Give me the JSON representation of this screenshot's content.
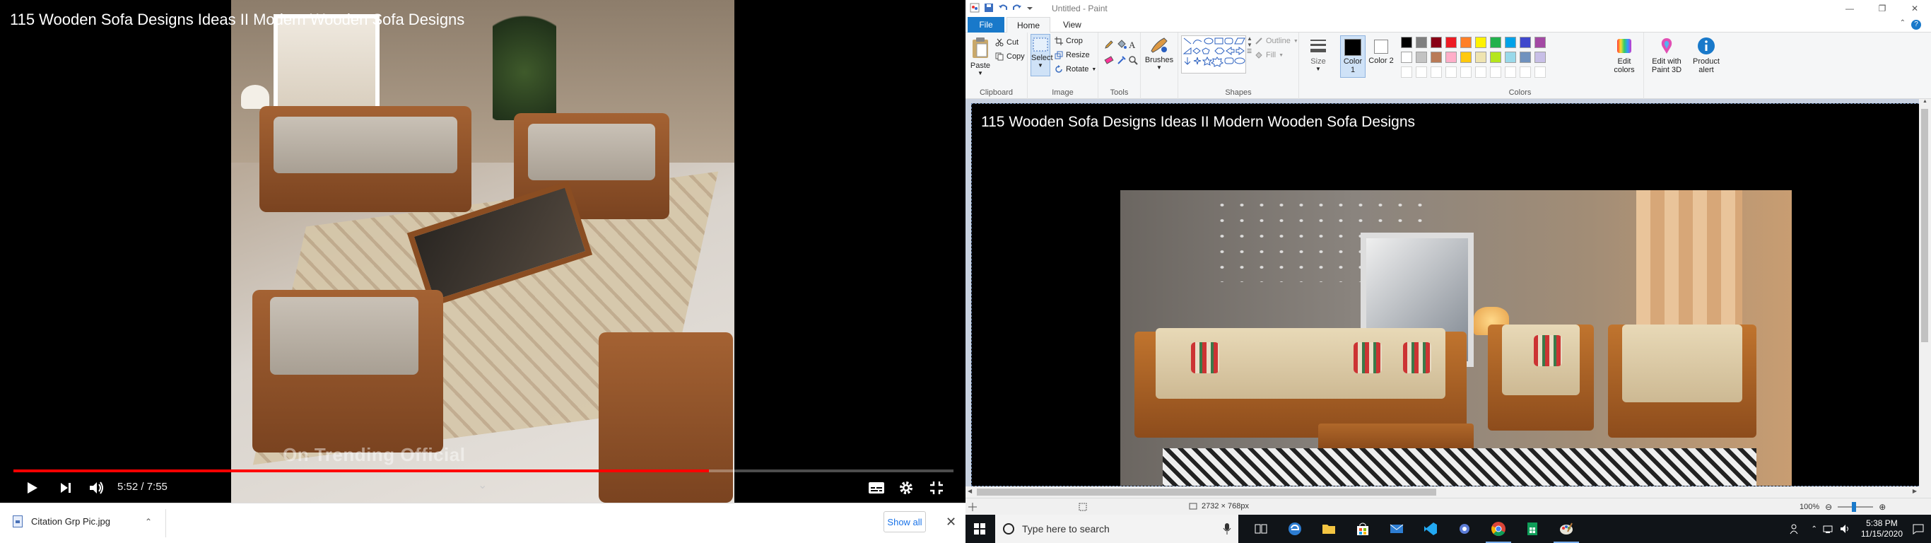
{
  "player": {
    "title": "115 Wooden Sofa Designs Ideas II Modern Wooden Sofa Designs",
    "watermark": "On Trending Official",
    "time": "5:52 / 7:55",
    "progress": 0.74
  },
  "downloads": {
    "file_name": "Citation Grp Pic.jpg",
    "show_all": "Show all"
  },
  "paint": {
    "window_title": "Untitled - Paint",
    "tabs": [
      "File",
      "Home",
      "View"
    ],
    "clipboard": {
      "paste": "Paste",
      "cut": "Cut",
      "copy": "Copy",
      "label": "Clipboard"
    },
    "image": {
      "select": "Select",
      "crop": "Crop",
      "resize": "Resize",
      "rotate": "Rotate",
      "label": "Image"
    },
    "tools": {
      "label": "Tools"
    },
    "brushes": "Brushes",
    "shapes": {
      "outline": "Outline",
      "fill": "Fill",
      "label": "Shapes"
    },
    "size": "Size",
    "color1": "Color 1",
    "color2": "Color 2",
    "colors": {
      "label": "Colors",
      "edit": "Edit colors",
      "palette": [
        "#000000",
        "#7f7f7f",
        "#880015",
        "#ed1c24",
        "#ff7f27",
        "#fff200",
        "#22b14c",
        "#00a2e8",
        "#3f48cc",
        "#a349a4",
        "#ffffff",
        "#c3c3c3",
        "#b97a57",
        "#ffaec9",
        "#ffc90e",
        "#efe4b0",
        "#b5e61d",
        "#99d9ea",
        "#7092be",
        "#c8bfe7"
      ]
    },
    "paint3d": "Edit with Paint 3D",
    "product_alert": "Product alert",
    "canvas_title": "115 Wooden Sofa Designs Ideas II Modern Wooden Sofa Designs",
    "status": {
      "dimensions": "2732 × 768px",
      "zoom": "100%"
    }
  },
  "taskbar": {
    "search_placeholder": "Type here to search",
    "time": "5:38 PM",
    "date": "11/15/2020"
  }
}
